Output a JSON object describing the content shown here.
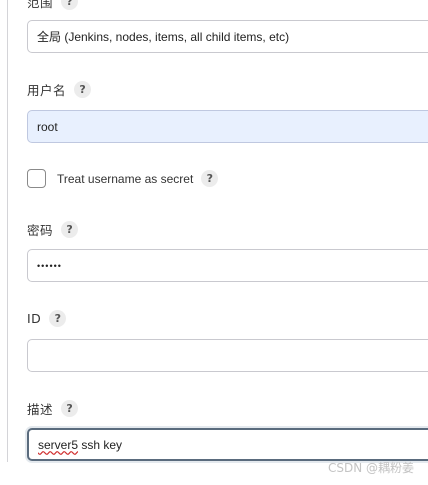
{
  "scope": {
    "label": "范围",
    "value": "全局 (Jenkins, nodes, items, all child items, etc)"
  },
  "username": {
    "label": "用户名",
    "value": "root"
  },
  "treat_secret": {
    "label": "Treat username as secret",
    "checked": false
  },
  "password": {
    "label": "密码",
    "value": "••••••"
  },
  "id_field": {
    "label": "ID",
    "value": ""
  },
  "description": {
    "label": "描述",
    "value_part1": "server5",
    "value_part2": " ssh key"
  },
  "help_glyph": "?",
  "watermark": "CSDN @耦粉姜"
}
